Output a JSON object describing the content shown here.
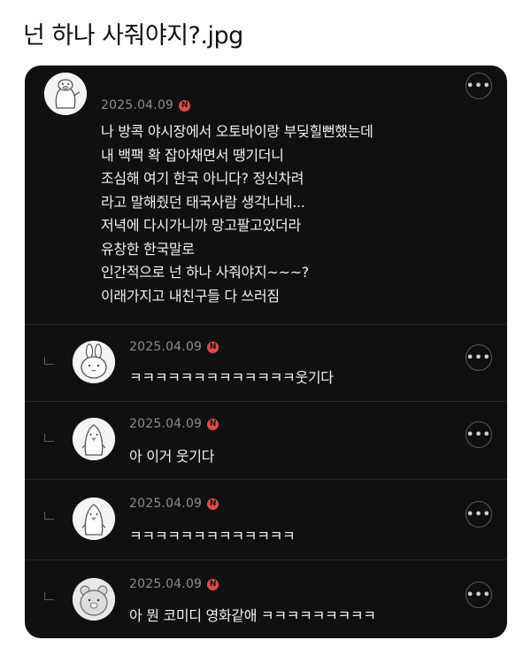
{
  "title": "넌 하나 사줘야지?.jpg",
  "post": {
    "date": "2025.04.09",
    "badge": "N",
    "more": "•••",
    "avatar_icon": "duck-character-icon",
    "lines": [
      "나 방콕 야시장에서 오토바이랑 부딪힐뻔했는데",
      "내 백팩 확 잡아채면서 땡기더니",
      "조심해 여기 한국 아니다? 정신차려",
      "라고 말해줬던 태국사람 생각나네...",
      "저녁에 다시가니까 망고팔고있더라",
      "유창한 한국말로",
      "인간적으로 넌 하나 사줘야지~~~?",
      "이래가지고 내친구들 다 쓰러짐"
    ]
  },
  "replies": [
    {
      "date": "2025.04.09",
      "badge": "N",
      "more": "•••",
      "avatar_icon": "rabbit-character-icon",
      "text": "ㅋㅋㅋㅋㅋㅋㅋㅋㅋㅋㅋㅋㅋ웃기다"
    },
    {
      "date": "2025.04.09",
      "badge": "N",
      "more": "•••",
      "avatar_icon": "penguin-character-icon",
      "text": "아 이거 웃기다"
    },
    {
      "date": "2025.04.09",
      "badge": "N",
      "more": "•••",
      "avatar_icon": "penguin-character-icon",
      "text": "ㅋㅋㅋㅋㅋㅋㅋㅋㅋㅋㅋㅋㅋ"
    },
    {
      "date": "2025.04.09",
      "badge": "N",
      "more": "•••",
      "avatar_icon": "bear-character-icon",
      "text": "아 뭔 코미디 영화같애 ㅋㅋㅋㅋㅋㅋㅋㅋㅋ"
    }
  ]
}
